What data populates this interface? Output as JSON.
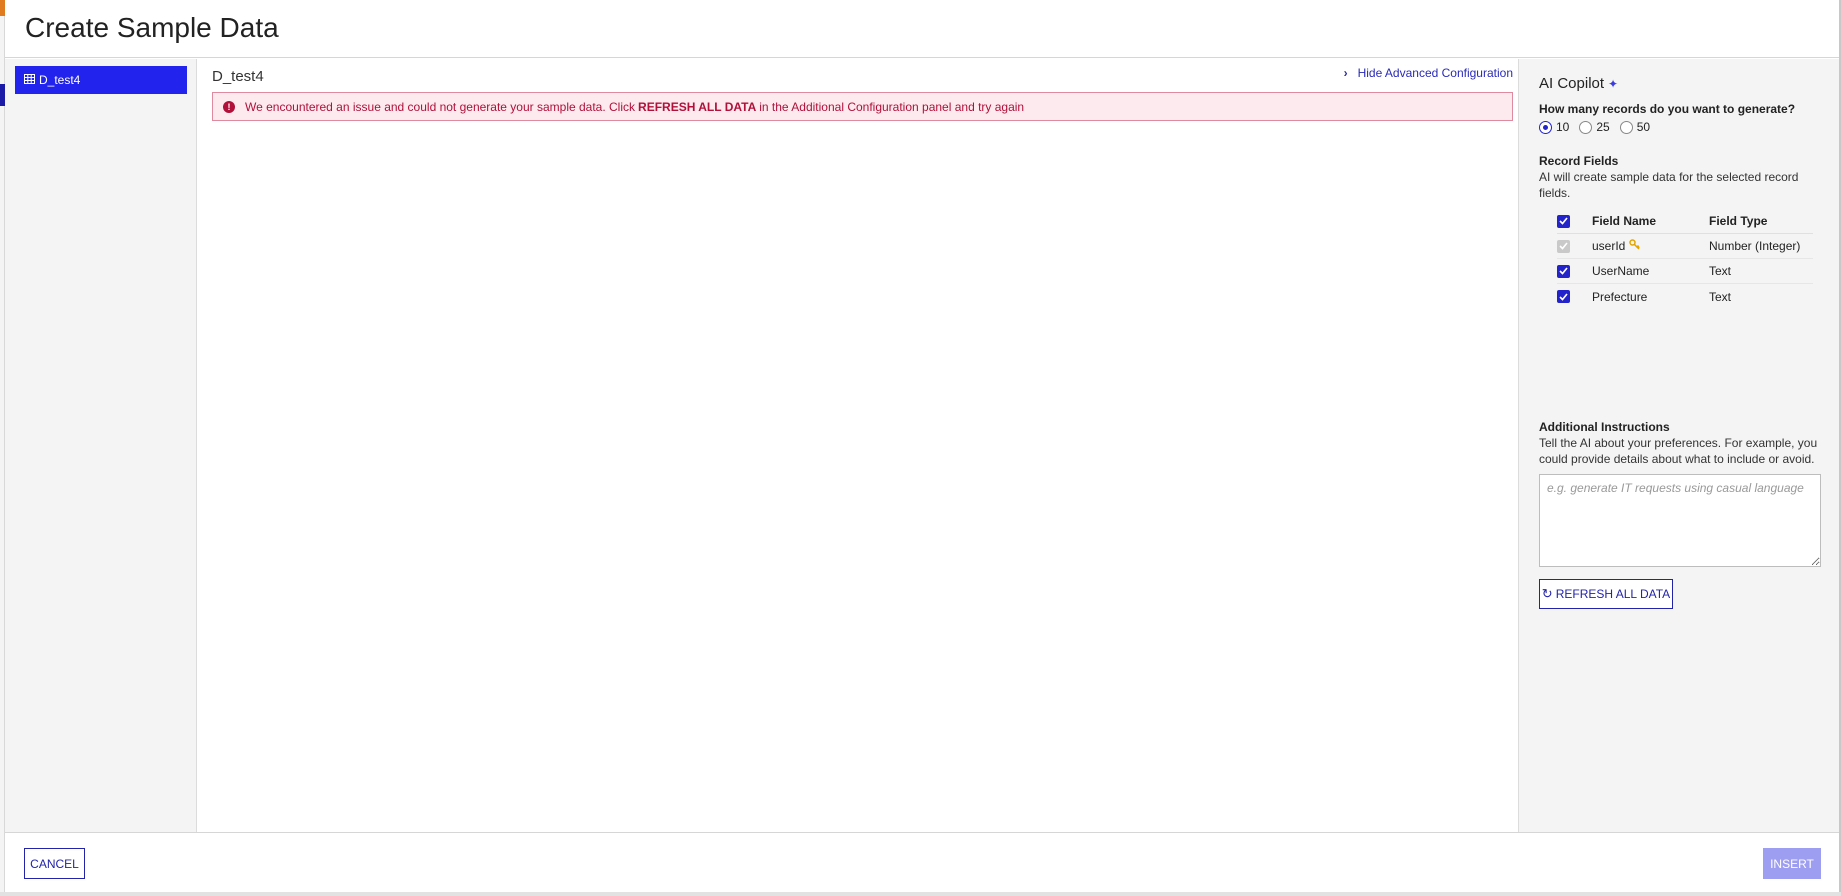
{
  "modal": {
    "title": "Create Sample Data"
  },
  "sidebar": {
    "items": [
      {
        "label": "D_test4",
        "icon": "table-icon",
        "selected": true
      }
    ]
  },
  "main": {
    "title": "D_test4",
    "toggle_label": "Hide Advanced Configuration",
    "error": {
      "prefix": "We encountered an issue and could not generate your sample data. Click",
      "emphasis": "REFRESH ALL DATA",
      "suffix": "in the Additional Configuration panel and try again"
    }
  },
  "copilot": {
    "title": "AI Copilot",
    "records_question": "How many records do you want to generate?",
    "record_options": [
      "10",
      "25",
      "50"
    ],
    "selected_records": "10",
    "record_fields_title": "Record Fields",
    "record_fields_desc": "AI will create sample data for the selected record fields.",
    "table": {
      "headers": {
        "name": "Field Name",
        "type": "Field Type"
      },
      "rows": [
        {
          "name": "userId",
          "type": "Number (Integer)",
          "checked": true,
          "disabled": true,
          "primary_key": true
        },
        {
          "name": "UserName",
          "type": "Text",
          "checked": true,
          "disabled": false,
          "primary_key": false
        },
        {
          "name": "Prefecture",
          "type": "Text",
          "checked": true,
          "disabled": false,
          "primary_key": false
        }
      ]
    },
    "additional_title": "Additional Instructions",
    "additional_desc": "Tell the AI about your preferences. For example, you could provide details about what to include or avoid.",
    "instructions_value": "",
    "instructions_placeholder": "e.g. generate IT requests using casual language",
    "refresh_label": "REFRESH ALL DATA"
  },
  "footer": {
    "cancel_label": "CANCEL",
    "insert_label": "INSERT"
  },
  "colors": {
    "accent": "#2323cc",
    "selected_item": "#2323ee",
    "error_text": "#b0103a",
    "error_bg": "#fdeaee",
    "disabled_button": "#9d9df2"
  }
}
